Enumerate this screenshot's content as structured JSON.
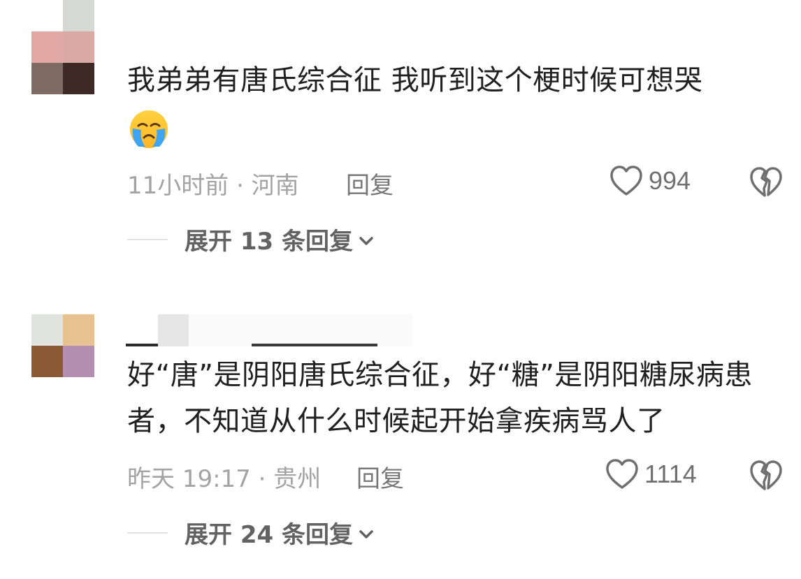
{
  "comments": [
    {
      "avatar_colors": [
        "#f2f2f2",
        "#d4d6d2",
        "#e2a8a4",
        "#d8a7a1",
        "#7e6b63",
        "#3d2a27"
      ],
      "text": "我弟弟有唐氏综合征 我听到这个梗时候可想哭",
      "emoji_icon": "crying-face-icon",
      "time": "11小时前",
      "location": "河南",
      "time_location": "11小时前 · 河南",
      "reply_label": "回复",
      "like_count": "994",
      "expand_label": "展开 13 条回复"
    },
    {
      "avatar_colors": [
        "#e1e3e0",
        "#e7c18f",
        "#8b5a35",
        "#b58fb1"
      ],
      "text": "好“唐”是阴阳唐氏综合征，好“糖”是阴阳糖尿病患者，不知道从什么时候起开始拿疾病骂人了",
      "time": "昨天 19:17",
      "location": "贵州",
      "time_location": "昨天 19:17 · 贵州",
      "reply_label": "回复",
      "like_count": "1114",
      "expand_label": "展开 24 条回复"
    }
  ],
  "colors": {
    "heart_outline": "#6f6f6f",
    "meta_text": "#a3a3a3",
    "body_text": "#202020"
  }
}
